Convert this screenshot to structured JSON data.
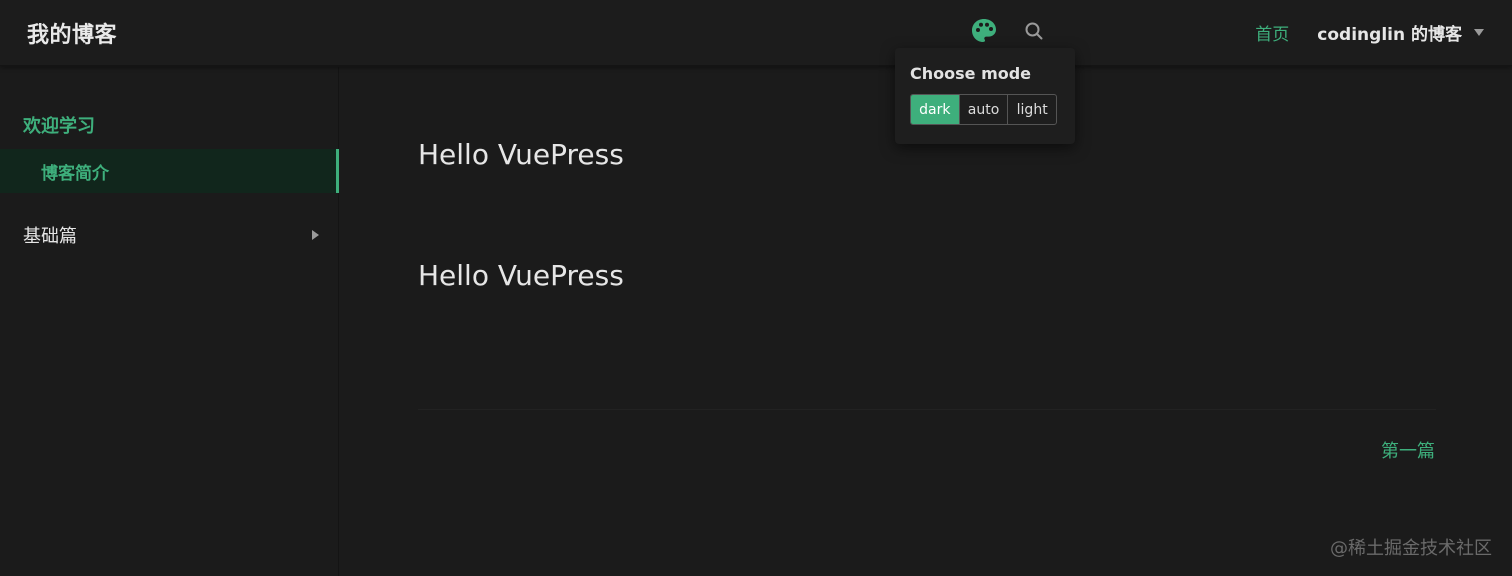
{
  "navbar": {
    "site_title": "我的博客",
    "palette_icon": "palette-icon",
    "search_icon": "search-icon",
    "links": [
      {
        "label": "首页"
      }
    ],
    "dropdown_label": "codinglin 的博客"
  },
  "mode_popup": {
    "title": "Choose mode",
    "options": [
      "dark",
      "auto",
      "light"
    ],
    "selected": "dark"
  },
  "sidebar": {
    "group_title": "欢迎学习",
    "active_item": "博客简介",
    "collapsible_item": "基础篇"
  },
  "content": {
    "heading_1": "Hello VuePress",
    "heading_2": "Hello VuePress",
    "next_link": "第一篇"
  },
  "watermark": "@稀土掘金技术社区",
  "colors": {
    "accent": "#3eaf7c",
    "background": "#1b1b1b",
    "text": "#e6e6e6"
  }
}
